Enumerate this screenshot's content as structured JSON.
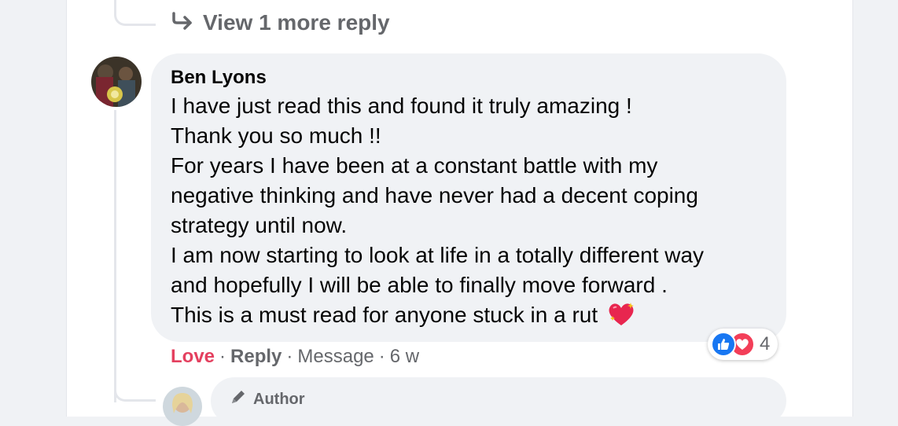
{
  "view_more": {
    "label": "View 1 more reply",
    "icon": "reply-arrow-icon"
  },
  "comment": {
    "author": "Ben Lyons",
    "lines": [
      "I have just read this and found it truly amazing !",
      "Thank you so much !!",
      "For years I have been at a constant battle with my",
      "negative thinking and have never had a decent coping",
      "strategy until now.",
      "I am now starting to look at life in a totally different way",
      "and hopefully I will be able to finally move forward .",
      "This is a must read for anyone stuck in a rut"
    ],
    "emoji": "sparkling-heart-icon",
    "actions": {
      "love": "Love",
      "reply": "Reply",
      "message": "Message",
      "time": "6 w",
      "separator": "·"
    },
    "reactions": {
      "icons": [
        "like-icon",
        "love-icon"
      ],
      "count": "4"
    }
  },
  "next_reply": {
    "badge": "Author",
    "badge_icon": "pencil-icon"
  },
  "colors": {
    "love_red": "#e4405f",
    "like_blue": "#1877f2",
    "bubble_bg": "#f0f2f5",
    "muted_text": "#65676b"
  }
}
